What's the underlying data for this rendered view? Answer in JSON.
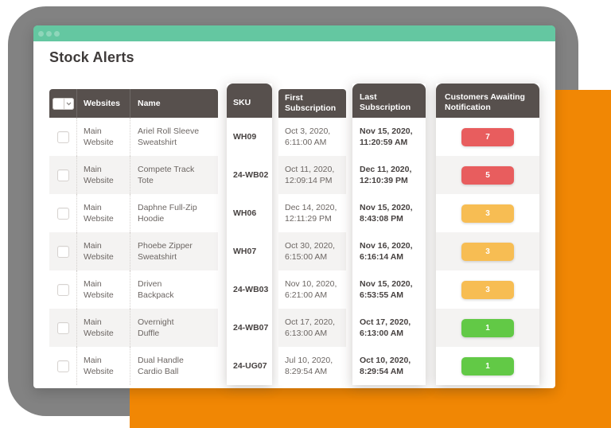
{
  "window": {
    "title": "Stock Alerts",
    "titlebar_dots": 3
  },
  "colors": {
    "titlebar_teal": "#64C7A1",
    "titlebar_dot": "#8FD6BA",
    "backdrop_gray": "#828282",
    "orange_accent": "#F18704",
    "header_bg": "#57504D",
    "row_stripe": "#F4F3F2",
    "badge_red": "#E85D5E",
    "badge_yellow": "#F7BD53",
    "badge_green": "#62C946"
  },
  "icons": {
    "select_all_dropdown": "chevron-down"
  },
  "table": {
    "columns": {
      "select": {
        "label": ""
      },
      "websites": {
        "label": "Websites"
      },
      "name": {
        "label": "Name"
      },
      "sku": {
        "label": "SKU"
      },
      "first": {
        "label": "First\nSubscription"
      },
      "last": {
        "label": "Last\nSubscription"
      },
      "customers": {
        "label": "Customers Awaiting\nNotification"
      }
    },
    "rows": [
      {
        "website": "Main Website",
        "name": "Ariel Roll Sleeve\nSweatshirt",
        "sku": "WH09",
        "first_subscription": "Oct 3, 2020,\n6:11:00 AM",
        "last_subscription": "Nov 15, 2020,\n11:20:59 AM",
        "customers_awaiting": "7",
        "severity": "high"
      },
      {
        "website": "Main Website",
        "name": "Compete Track\nTote",
        "sku": "24-WB02",
        "first_subscription": "Oct 11, 2020,\n12:09:14 PM",
        "last_subscription": "Dec 11, 2020,\n12:10:39 PM",
        "customers_awaiting": "5",
        "severity": "high"
      },
      {
        "website": "Main Website",
        "name": "Daphne Full-Zip\nHoodie",
        "sku": "WH06",
        "first_subscription": "Dec 14, 2020,\n12:11:29 PM",
        "last_subscription": "Nov 15, 2020,\n8:43:08 PM",
        "customers_awaiting": "3",
        "severity": "medium"
      },
      {
        "website": "Main Website",
        "name": "Phoebe Zipper\nSweatshirt",
        "sku": "WH07",
        "first_subscription": "Oct 30, 2020,\n6:15:00 AM",
        "last_subscription": "Nov 16, 2020,\n6:16:14 AM",
        "customers_awaiting": "3",
        "severity": "medium"
      },
      {
        "website": "Main Website",
        "name": "Driven\nBackpack",
        "sku": "24-WB03",
        "first_subscription": "Nov 10, 2020,\n6:21:00 AM",
        "last_subscription": "Nov 15, 2020,\n6:53:55 AM",
        "customers_awaiting": "3",
        "severity": "medium"
      },
      {
        "website": "Main Website",
        "name": "Overnight\nDuffle",
        "sku": "24-WB07",
        "first_subscription": "Oct 17, 2020,\n6:13:00 AM",
        "last_subscription": "Oct 17, 2020,\n6:13:00 AM",
        "customers_awaiting": "1",
        "severity": "low"
      },
      {
        "website": "Main Website",
        "name": "Dual Handle\nCardio Ball",
        "sku": "24-UG07",
        "first_subscription": "Jul 10, 2020,\n8:29:54 AM",
        "last_subscription": "Oct 10, 2020,\n8:29:54 AM",
        "customers_awaiting": "1",
        "severity": "low"
      }
    ]
  }
}
